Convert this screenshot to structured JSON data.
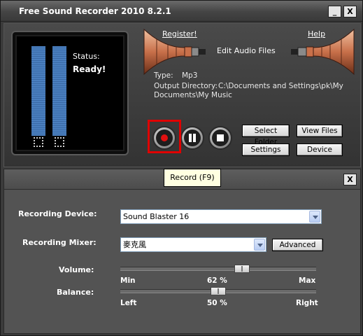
{
  "window": {
    "title": "Free Sound Recorder 2010 8.2.1",
    "minimize_label": "_",
    "close_label": "X"
  },
  "status": {
    "label": "Status:",
    "value": "Ready!"
  },
  "links": {
    "register": "Register!",
    "help": "Help",
    "edit_audio": "Edit Audio Files"
  },
  "output": {
    "type_label": "Type:",
    "type_value": "Mp3",
    "dir_label": "Output Directory:",
    "dir_value_line1": "C:\\Documents and Settings\\pk\\My",
    "dir_value_line2": "Documents\\My Music"
  },
  "buttons": {
    "select_folder": "Select Folder",
    "view_files": "View Files",
    "settings": "Settings",
    "device": "Device"
  },
  "tooltip": "Record (F9)",
  "panel": {
    "close_label": "X",
    "recording_device_label": "Recording Device:",
    "recording_device_value": "Sound Blaster 16",
    "recording_mixer_label": "Recording Mixer:",
    "recording_mixer_value": "麥克風",
    "advanced_label": "Advanced",
    "volume_label": "Volume:",
    "volume_min": "Min",
    "volume_value": "62 %",
    "volume_max": "Max",
    "volume_level": 0.62,
    "balance_label": "Balance:",
    "balance_left": "Left",
    "balance_value": "50 %",
    "balance_right": "Right",
    "balance_level": 0.5
  },
  "colors": {
    "record_highlight": "#e00000",
    "meter_bar": "#4a7fbf",
    "horn_copper": "#c8704a"
  },
  "icons": [
    "record-icon",
    "pause-icon",
    "stop-icon",
    "minimize-icon",
    "close-icon",
    "chevron-down-icon"
  ]
}
